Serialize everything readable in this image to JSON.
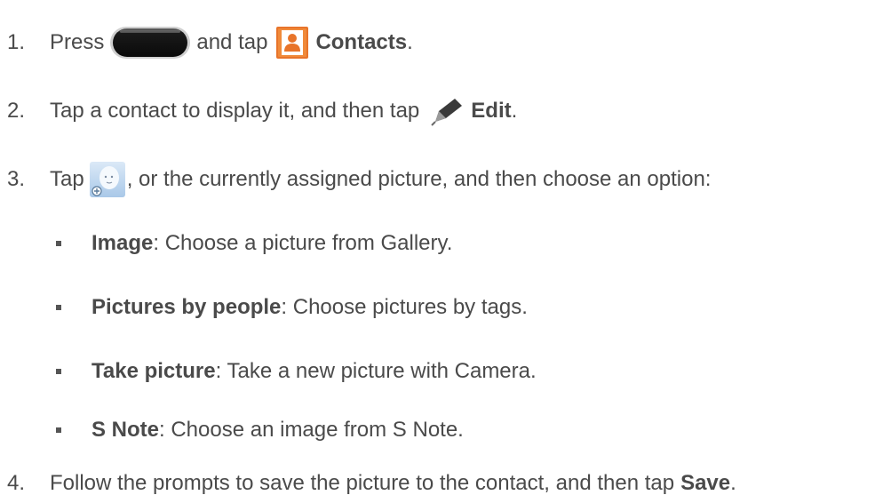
{
  "steps": [
    {
      "num": "1.",
      "a": "Press",
      "b": "and tap",
      "bold": "Contacts",
      "c": "."
    },
    {
      "num": "2.",
      "a": "Tap a contact to display it, and then tap",
      "bold": "Edit",
      "c": "."
    },
    {
      "num": "3.",
      "a": "Tap",
      "b": ", or the currently assigned picture, and then choose an option:"
    },
    {
      "num": "4.",
      "a": "Follow the prompts to save the picture to the contact, and then tap",
      "bold": "Save",
      "c": "."
    }
  ],
  "options": [
    {
      "label": "Image",
      "text": ": Choose a picture from Gallery."
    },
    {
      "label": "Pictures by people",
      "text": ": Choose pictures by tags."
    },
    {
      "label": "Take picture",
      "text": ": Take a new picture with Camera."
    },
    {
      "label": "S Note",
      "text": ": Choose an image from S Note."
    }
  ],
  "icons": {
    "home_button": "home-key-icon",
    "contacts": "contacts-app-icon",
    "edit": "pencil-edit-icon",
    "contact_picture": "contact-picture-placeholder-icon"
  },
  "colors": {
    "text": "#4a4a4a",
    "contacts_icon": "#e8742a",
    "home_button": "#2a2a2a"
  }
}
